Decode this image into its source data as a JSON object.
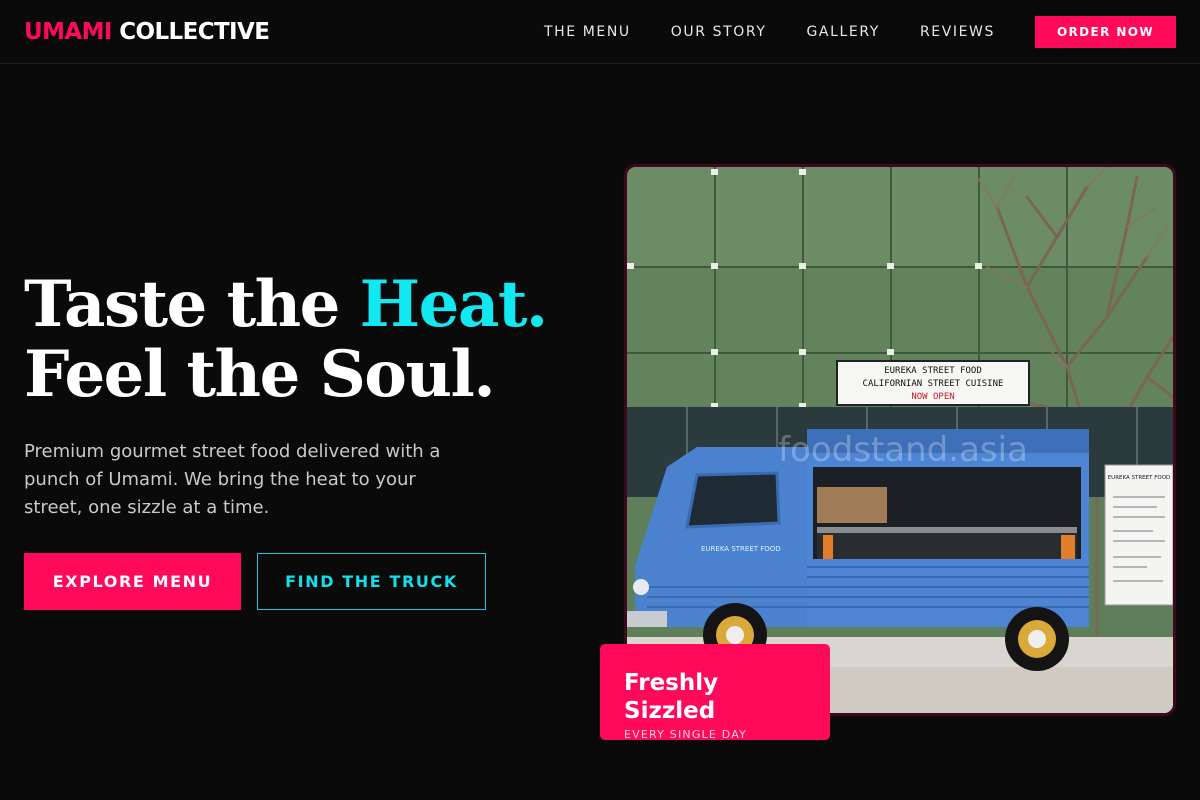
{
  "brand": {
    "accent": "UMAMI",
    "rest": "COLLECTIVE"
  },
  "nav": {
    "links": [
      "THE MENU",
      "OUR STORY",
      "GALLERY",
      "REVIEWS"
    ],
    "cta": "ORDER NOW"
  },
  "hero": {
    "title_line1_plain": "Taste the ",
    "title_line1_accent": "Heat.",
    "title_line2": "Feel the Soul.",
    "subtitle": "Premium gourmet street food delivered with a punch of Umami. We bring the heat to your street, one sizzle at a time.",
    "primary_button": "EXPLORE MENU",
    "secondary_button": "FIND THE TRUCK"
  },
  "image": {
    "sign_line1": "EUREKA STREET FOOD",
    "sign_line2": "CALIFORNIAN STREET CUISINE",
    "sign_line3": "NOW OPEN",
    "watermark": "foodstand.asia",
    "truck_text": "EUREKA STREET FOOD",
    "menu_board_title": "EUREKA STREET FOOD"
  },
  "badge": {
    "title": "Freshly Sizzled",
    "subtitle": "EVERY SINGLE DAY"
  },
  "colors": {
    "accent_pink": "#ff0a5a",
    "accent_cyan": "#12e8f0",
    "background": "#0a0a0b"
  }
}
